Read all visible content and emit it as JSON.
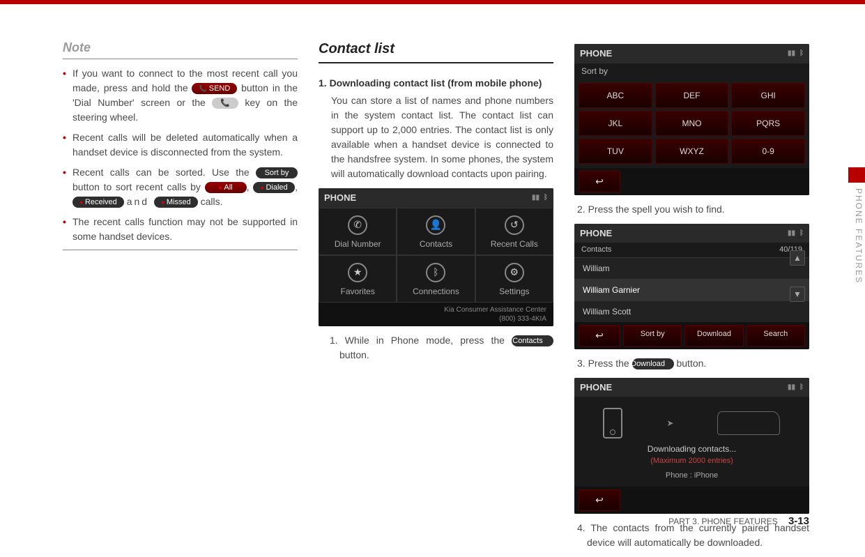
{
  "col1": {
    "note": "Note",
    "bullets": [
      {
        "pre": "If you want to connect to the most recent call you made, press and hold the ",
        "pill1": "SEND",
        "mid": " button in the 'Dial Number' screen or the ",
        "pill2": "📞",
        "post": " key on the steering wheel."
      },
      {
        "text": "Recent calls will be deleted automatically when a handset device is disconnected from the system."
      },
      {
        "pre": "Recent calls can be sorted. Use the ",
        "sortby": "Sort by",
        "mid1": " button to sort recent calls by ",
        "all": "All",
        "sep1": ", ",
        "dialed": "Dialed",
        "sep2": ", ",
        "received": "Received",
        "and": " and ",
        "missed": "Missed",
        "post": " calls."
      },
      {
        "text": "The recent calls function may not be supported in some handset devices."
      }
    ]
  },
  "col2": {
    "heading": "Contact list",
    "step1_bold": "1. Downloading contact list (from mobile phone)",
    "step1_body": "You can store a list of names and phone numbers in the system contact list. The contact list can support up to 2,000 entries. The contact list is only available when a handset device is connected to the handsfree system. In some phones, the system will automatically download contacts upon pairing.",
    "phone_main": {
      "title": "PHONE",
      "items": [
        "Dial Number",
        "Contacts",
        "Recent Calls",
        "Favorites",
        "Connections",
        "Settings"
      ],
      "footer1": "Kia Consumer Assistance Center",
      "footer2": "(800) 333-4KIA"
    },
    "sub1_pre": "1. While in Phone mode, press the ",
    "sub1_btn": "Contacts",
    "sub1_post": " button."
  },
  "col3": {
    "sortby_ui": {
      "title": "PHONE",
      "subtitle": "Sort by",
      "buttons": [
        "ABC",
        "DEF",
        "GHI",
        "JKL",
        "MNO",
        "PQRS",
        "TUV",
        "WXYZ",
        "0-9"
      ]
    },
    "step2": "2. Press the spell you wish to find.",
    "contacts_ui": {
      "title": "PHONE",
      "subtitle": "Contacts",
      "count": "40/119",
      "rows": [
        "William",
        "William Garnier",
        "William Scott"
      ],
      "bar": [
        "Sort by",
        "Download",
        "Search"
      ]
    },
    "step3_pre": "3. Press the ",
    "step3_btn": "Download",
    "step3_post": " button.",
    "dl_ui": {
      "title": "PHONE",
      "t1": "Downloading contacts...",
      "t2": "(Maximum 2000 entries)",
      "t3": "Phone : iPhone"
    },
    "step4": "4. The contacts from the currently paired handset device will automatically be downloaded."
  },
  "side_label": "PHONE FEATURES",
  "footer_part": "PART 3. PHONE FEATURES",
  "footer_page": "3-13"
}
